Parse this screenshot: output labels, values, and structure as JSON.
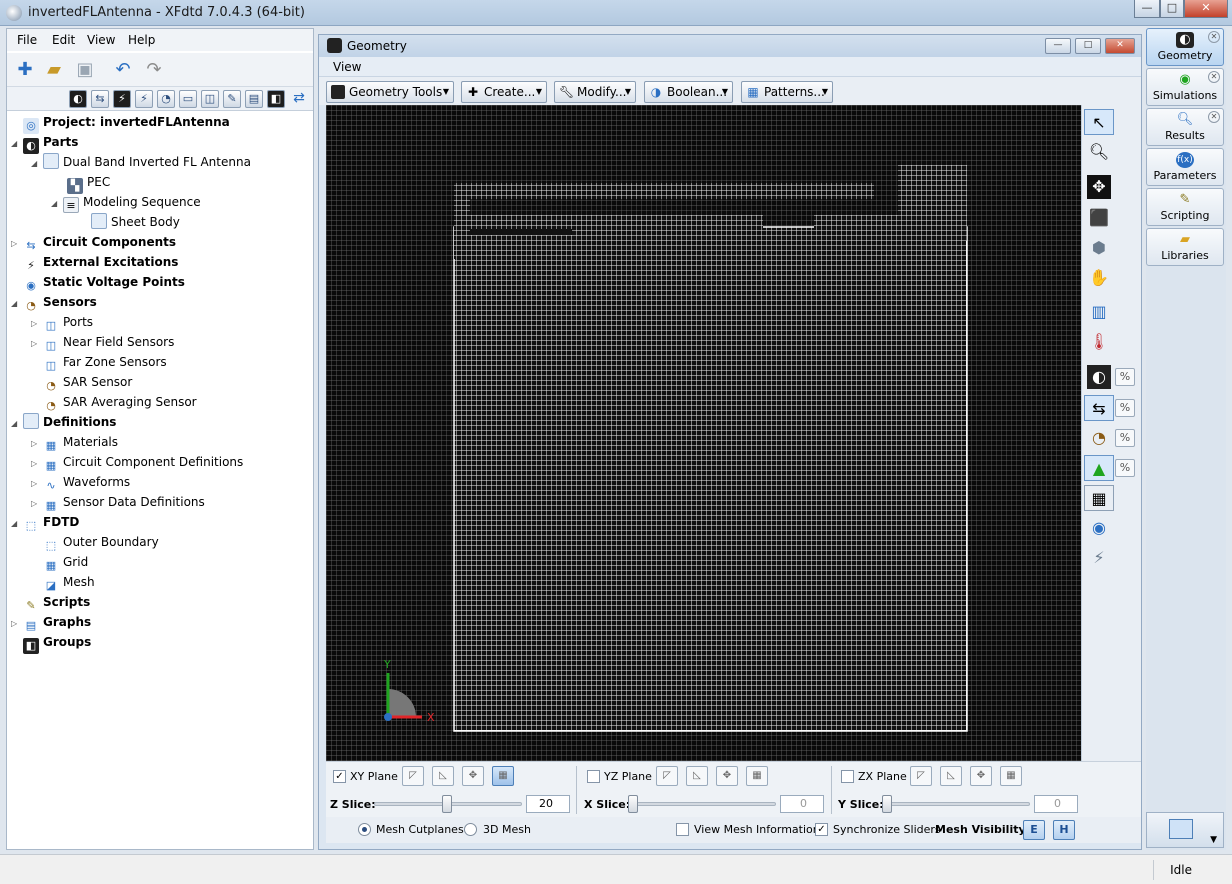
{
  "window": {
    "title": "invertedFLAntenna - XFdtd 7.0.4.3 (64-bit)",
    "minimize": "—",
    "maximize": "□",
    "close": "✕"
  },
  "menu": [
    "File",
    "Edit",
    "View",
    "Help"
  ],
  "tree": [
    {
      "label": "Project: invertedFLAntenna",
      "icon": "project-icon"
    },
    {
      "label": "Parts",
      "icon": "parts-icon"
    },
    {
      "label": "Dual Band Inverted FL Antenna",
      "icon": "part-icon"
    },
    {
      "label": "PEC",
      "icon": "material-icon"
    },
    {
      "label": "Modeling Sequence",
      "icon": "sequence-icon"
    },
    {
      "label": "Sheet Body",
      "icon": "sheet-body-icon"
    },
    {
      "label": "Circuit Components",
      "icon": "circuit-icon"
    },
    {
      "label": "External Excitations",
      "icon": "excitation-icon"
    },
    {
      "label": "Static Voltage Points",
      "icon": "voltage-point-icon"
    },
    {
      "label": "Sensors",
      "icon": "sensor-icon"
    },
    {
      "label": "Ports",
      "icon": "ports-icon"
    },
    {
      "label": "Near Field Sensors",
      "icon": "near-field-icon"
    },
    {
      "label": "Far Zone Sensors",
      "icon": "far-zone-icon"
    },
    {
      "label": "SAR Sensor",
      "icon": "sar-icon"
    },
    {
      "label": "SAR Averaging Sensor",
      "icon": "sar-avg-icon"
    },
    {
      "label": "Definitions",
      "icon": "definitions-icon"
    },
    {
      "label": "Materials",
      "icon": "materials-icon"
    },
    {
      "label": "Circuit Component Definitions",
      "icon": "circuit-def-icon"
    },
    {
      "label": "Waveforms",
      "icon": "waveform-icon"
    },
    {
      "label": "Sensor Data Definitions",
      "icon": "sensor-data-icon"
    },
    {
      "label": "FDTD",
      "icon": "fdtd-icon"
    },
    {
      "label": "Outer Boundary",
      "icon": "boundary-icon"
    },
    {
      "label": "Grid",
      "icon": "grid-icon"
    },
    {
      "label": "Mesh",
      "icon": "mesh-icon"
    },
    {
      "label": "Scripts",
      "icon": "scripts-icon"
    },
    {
      "label": "Graphs",
      "icon": "graphs-icon"
    },
    {
      "label": "Groups",
      "icon": "groups-icon"
    }
  ],
  "geometry": {
    "title": "Geometry",
    "menu": "View",
    "tools": [
      "Geometry Tools",
      "Create...",
      "Modify...",
      "Boolean...",
      "Patterns..."
    ],
    "axis_x": "X",
    "axis_y": "Y"
  },
  "planes": {
    "xy": {
      "label": "XY Plane",
      "checked": true,
      "slice_label": "Z Slice:",
      "slice_value": "20"
    },
    "yz": {
      "label": "YZ Plane",
      "checked": false,
      "slice_label": "X Slice:",
      "slice_value": "0"
    },
    "zx": {
      "label": "ZX Plane",
      "checked": false,
      "slice_label": "Y Slice:",
      "slice_value": "0"
    }
  },
  "bottom": {
    "mesh_cutplanes": "Mesh Cutplanes",
    "mesh_3d": "3D Mesh",
    "view_mesh_info": "View Mesh Information",
    "sync_sliders": "Synchronize Sliders",
    "mesh_visibility": "Mesh Visibility:",
    "e_button": "E",
    "h_button": "H"
  },
  "pct": "%",
  "dock": [
    "Geometry",
    "Simulations",
    "Results",
    "Parameters",
    "Scripting",
    "Libraries"
  ],
  "status": "Idle",
  "colors": {
    "accent": "#2b6fc2",
    "viewport_bg": "#0a0a0a",
    "mesh": "#ffffff"
  }
}
